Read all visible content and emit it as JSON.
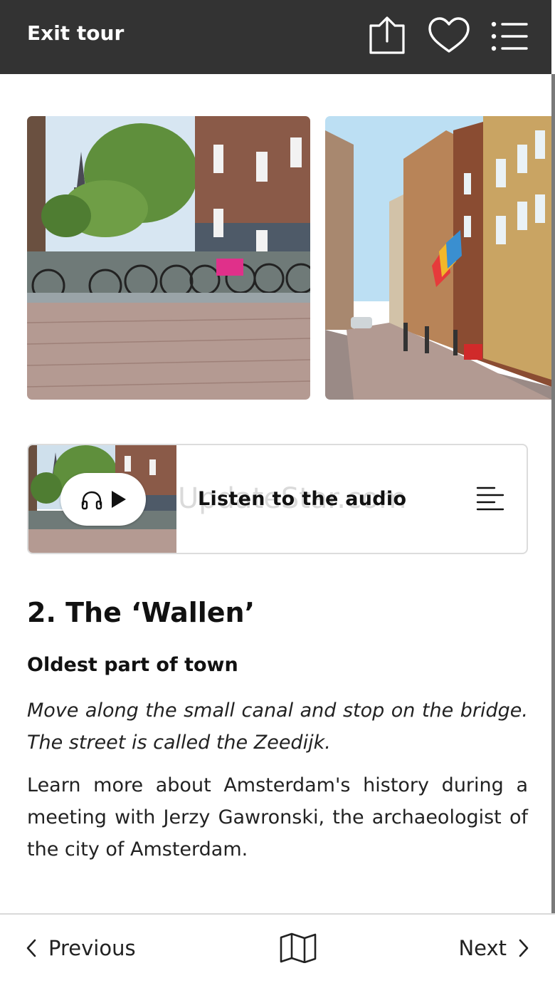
{
  "header": {
    "exit_label": "Exit tour",
    "icons": [
      "share-icon",
      "heart-icon",
      "list-menu-icon"
    ]
  },
  "gallery": {
    "images": [
      "canal-bridge-bicycles-photo",
      "zeedijk-street-photo"
    ]
  },
  "audio": {
    "label": "Listen to the audio",
    "icons": [
      "headphones-icon",
      "play-icon",
      "transcript-icon"
    ]
  },
  "watermark": "UpdateStar.com",
  "stop": {
    "title": "2. The ‘Wallen’",
    "subtitle": "Oldest part of town",
    "directions": "Move along the small canal and stop on the bridge. The street is called the Zeedijk.",
    "body": "Learn more about Amsterdam's history during a meeting with Jerzy Gawronski, the archaeologist of the city of Amsterdam."
  },
  "nav": {
    "previous_label": "Previous",
    "next_label": "Next",
    "map_icon": "map-icon"
  },
  "colors": {
    "header_bg": "#333333",
    "text": "#111111",
    "divider": "#d9d9d9"
  }
}
